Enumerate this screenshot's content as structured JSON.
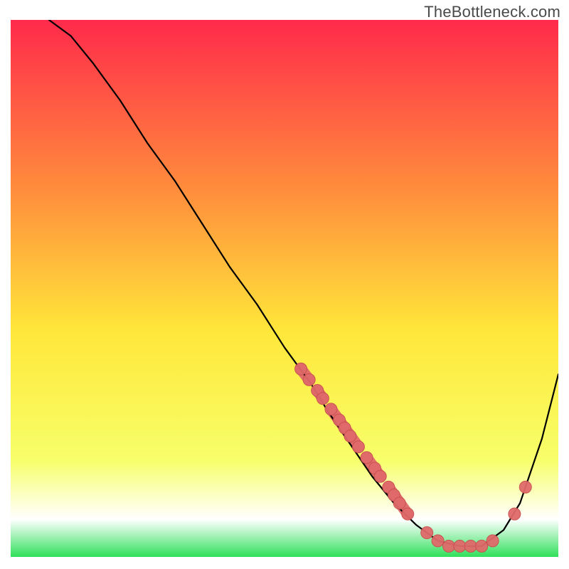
{
  "watermark": "TheBottleneck.com",
  "chart_data": {
    "type": "line",
    "title": "",
    "xlabel": "",
    "ylabel": "",
    "xlim": [
      0,
      100
    ],
    "ylim": [
      0,
      100
    ],
    "grid": false,
    "legend": false,
    "background_gradient": {
      "top_color": "#ff2a4b",
      "mid_upper_color": "#ff8e3c",
      "mid_color": "#ffe73a",
      "mid_lower_color": "#f7ff6a",
      "band_color": "#ffffff",
      "bottom_color": "#2fe05a"
    },
    "series": [
      {
        "name": "bottleneck-curve",
        "stroke": "#000000",
        "x": [
          7,
          11,
          15,
          20,
          25,
          30,
          35,
          40,
          45,
          50,
          55,
          58,
          62,
          66,
          70,
          74,
          78,
          82,
          86,
          90,
          93,
          97,
          100
        ],
        "y": [
          100,
          97,
          92,
          85,
          77,
          70,
          62,
          54,
          47,
          39,
          32,
          27,
          21,
          15,
          10,
          6,
          3,
          2,
          2,
          5,
          10,
          22,
          34
        ]
      }
    ],
    "marker_points": {
      "name": "highlight-dots",
      "fill": "#e06a6a",
      "stroke": "#c94f4f",
      "x": [
        53,
        54.5,
        56,
        57,
        58.5,
        60,
        61,
        62,
        63.5,
        65,
        66.5,
        67.5,
        69,
        70,
        71,
        72.5,
        76,
        78,
        80,
        82,
        84,
        86,
        88,
        92,
        94
      ],
      "y": [
        35,
        33,
        31,
        29.5,
        27.5,
        25.5,
        24,
        22.5,
        20.5,
        18.5,
        16.5,
        15,
        13,
        11.5,
        10,
        8,
        4.5,
        3,
        2,
        2,
        2,
        2,
        3,
        8,
        13
      ]
    },
    "marker_segments": [
      {
        "x0": 53.0,
        "y0": 35.0,
        "x1": 54.5,
        "y1": 33.0
      },
      {
        "x0": 56.0,
        "y0": 31.0,
        "x1": 57.0,
        "y1": 29.5
      },
      {
        "x0": 58.5,
        "y0": 27.5,
        "x1": 63.5,
        "y1": 20.5
      },
      {
        "x0": 65.0,
        "y0": 18.5,
        "x1": 67.5,
        "y1": 15.0
      },
      {
        "x0": 69.0,
        "y0": 13.0,
        "x1": 72.5,
        "y1": 8.0
      }
    ]
  }
}
